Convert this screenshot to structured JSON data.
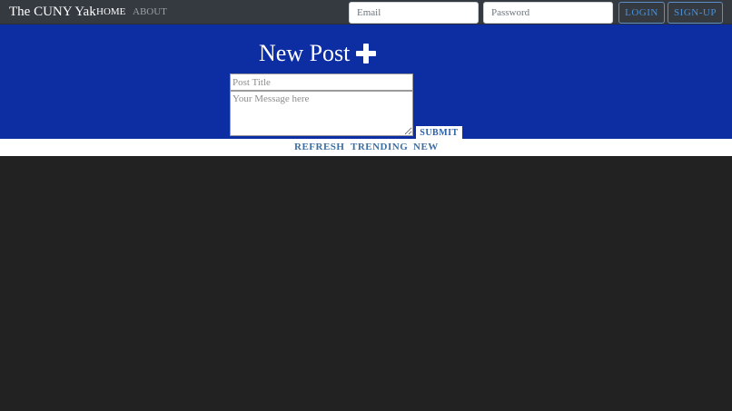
{
  "navbar": {
    "brand": "The CUNY Yak",
    "links": [
      {
        "label": "HOME"
      },
      {
        "label": "ABOUT"
      }
    ],
    "email_placeholder": "Email",
    "password_placeholder": "Password",
    "login_label": "LOGIN",
    "signup_label": "SIGN-UP"
  },
  "new_post": {
    "heading": "New Post",
    "heading_icon": "plus-icon",
    "title_placeholder": "Post Title",
    "message_placeholder": "Your Message here",
    "submit_label": "SUBMIT"
  },
  "filters": [
    {
      "label": "REFRESH"
    },
    {
      "label": "TRENDING"
    },
    {
      "label": "NEW"
    }
  ],
  "colors": {
    "navbar_bg": "#343a40",
    "hero_bg": "#0d2ea3",
    "feed_bg": "#222222",
    "accent_link": "#3e6ea1",
    "nav_button": "#4a90d9"
  }
}
